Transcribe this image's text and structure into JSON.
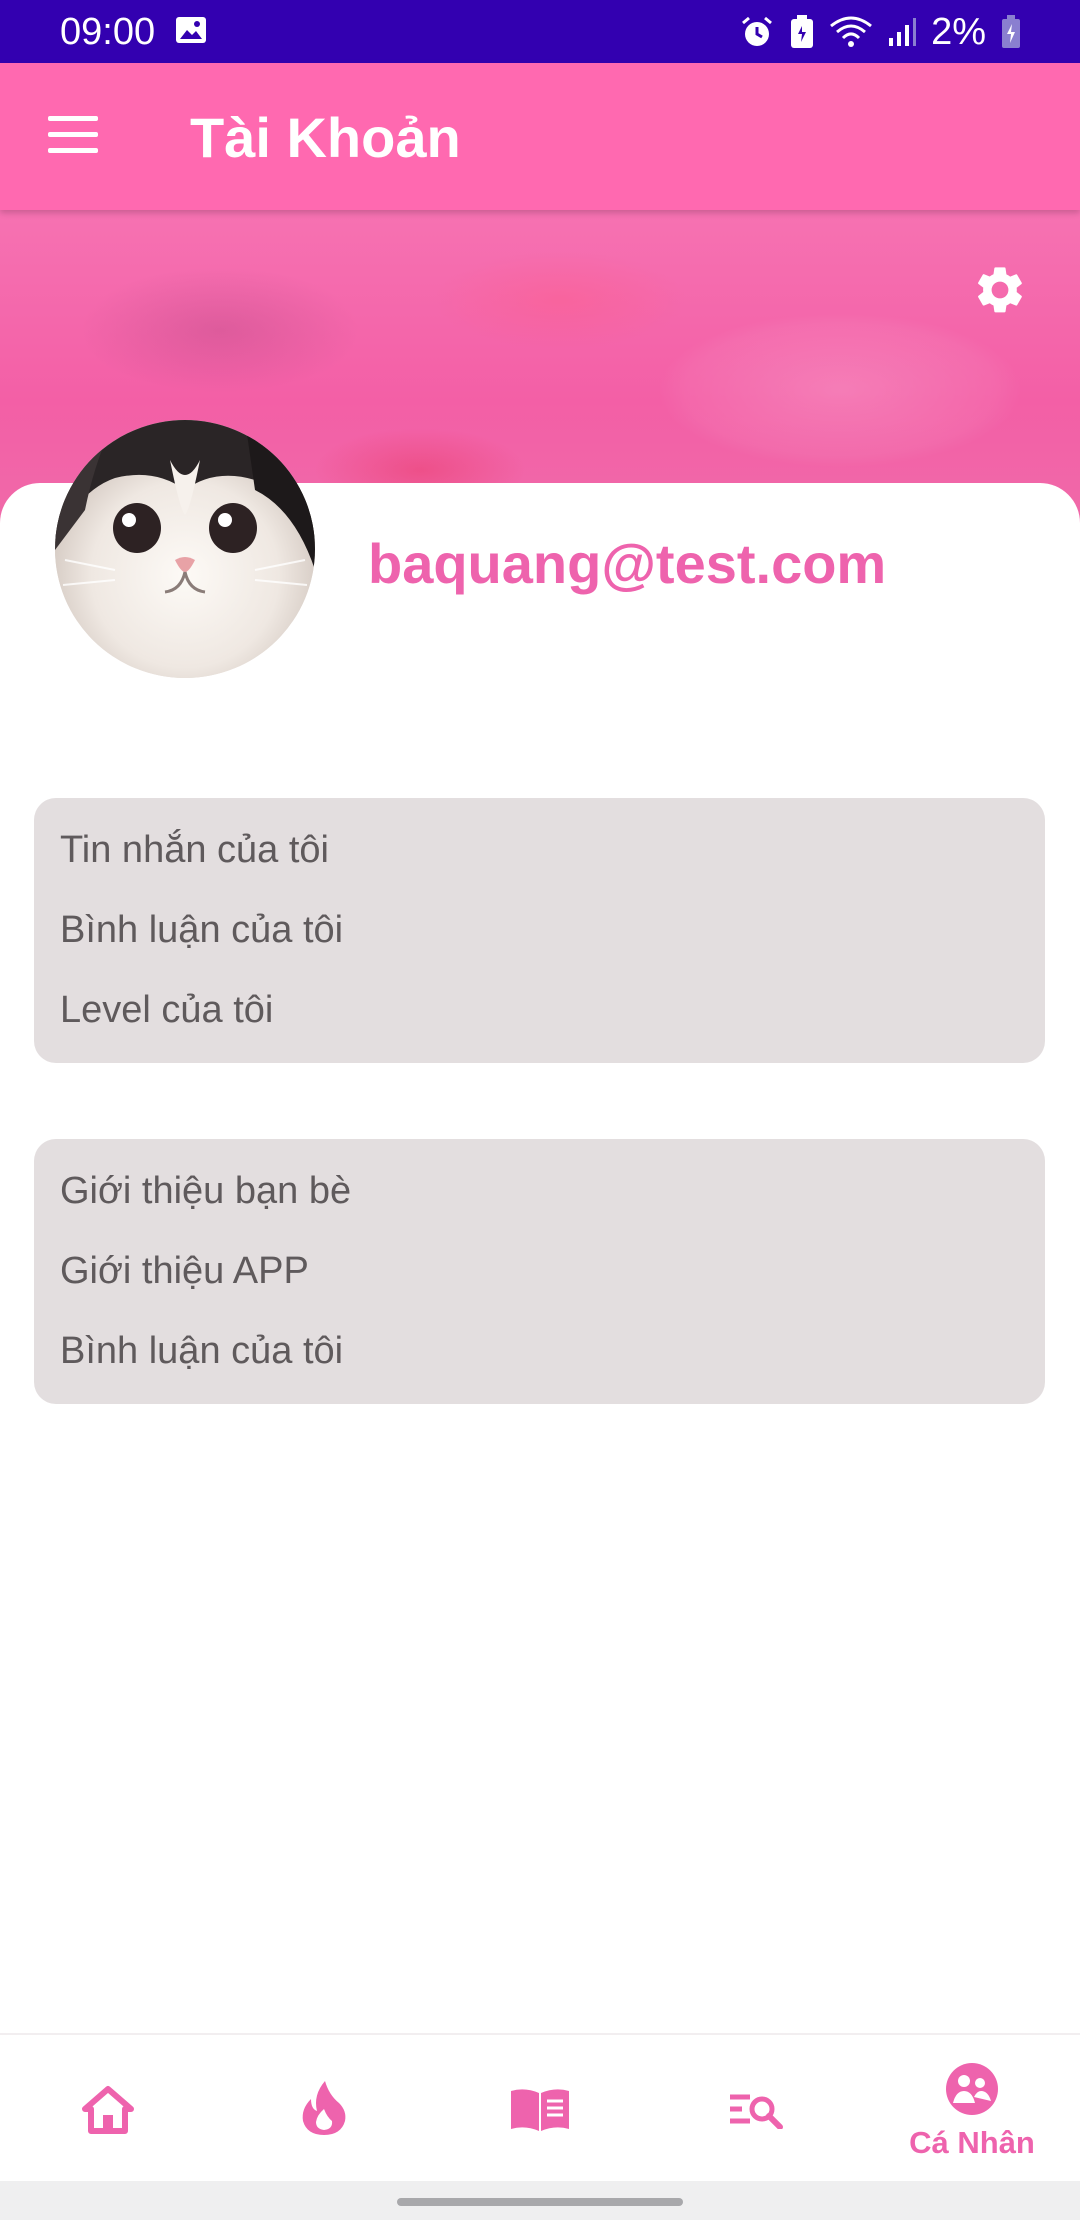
{
  "status_bar": {
    "time": "09:00",
    "battery_text": "2%",
    "icons": [
      "image-icon",
      "alarm-icon",
      "battery-saver-icon",
      "wifi-icon",
      "signal-icon",
      "battery-charging-icon"
    ]
  },
  "app_bar": {
    "title": "Tài Khoản",
    "menu_icon": "hamburger-menu-icon"
  },
  "header": {
    "settings_icon": "gear-icon"
  },
  "profile": {
    "email": "baquang@test.com",
    "avatar": "cat-avatar"
  },
  "menu_group_1": {
    "items": [
      {
        "label": "Tin nhắn của tôi"
      },
      {
        "label": "Bình luận của tôi"
      },
      {
        "label": "Level của tôi"
      }
    ]
  },
  "menu_group_2": {
    "items": [
      {
        "label": "Giới thiệu bạn bè"
      },
      {
        "label": "Giới thiệu APP"
      },
      {
        "label": "Bình luận của tôi"
      }
    ]
  },
  "bottom_nav": {
    "items": [
      {
        "icon": "home-icon",
        "label": ""
      },
      {
        "icon": "flame-icon",
        "label": ""
      },
      {
        "icon": "book-icon",
        "label": ""
      },
      {
        "icon": "search-list-icon",
        "label": ""
      },
      {
        "icon": "profile-icon",
        "label": "Cá Nhân",
        "active": true
      }
    ]
  },
  "colors": {
    "status_bar": "#3300b0",
    "primary": "#ff69b0",
    "accent_text": "#ee63ad",
    "card_bg": "#e3dedf"
  }
}
